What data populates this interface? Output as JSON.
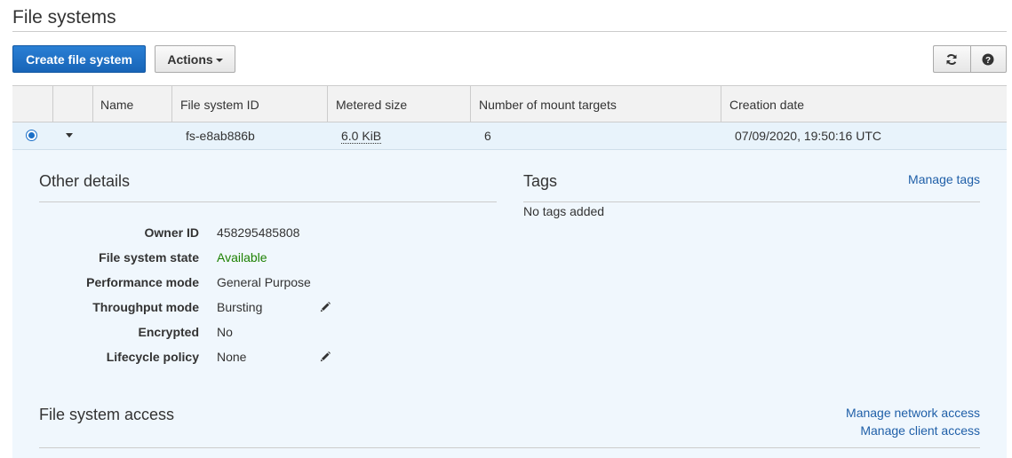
{
  "page": {
    "title": "File systems"
  },
  "toolbar": {
    "create_label": "Create file system",
    "actions_label": "Actions",
    "refresh_icon": "refresh-icon",
    "help_icon": "help-icon"
  },
  "table": {
    "columns": [
      "Name",
      "File system ID",
      "Metered size",
      "Number of mount targets",
      "Creation date"
    ],
    "row": {
      "name": "",
      "id": "fs-e8ab886b",
      "size": "6.0 KiB",
      "mount_targets": "6",
      "created": "07/09/2020, 19:50:16 UTC"
    }
  },
  "details": {
    "other_title": "Other details",
    "fields": [
      {
        "label": "Owner ID",
        "value": "458295485808"
      },
      {
        "label": "File system state",
        "value": "Available"
      },
      {
        "label": "Performance mode",
        "value": "General Purpose"
      },
      {
        "label": "Throughput mode",
        "value": "Bursting"
      },
      {
        "label": "Encrypted",
        "value": "No"
      },
      {
        "label": "Lifecycle policy",
        "value": "None"
      }
    ],
    "tags_title": "Tags",
    "manage_tags": "Manage tags",
    "no_tags": "No tags added",
    "access_title": "File system access",
    "manage_network": "Manage network access",
    "manage_client": "Manage client access"
  },
  "colors": {
    "primary": "#1a6fc7",
    "available": "#1d8102",
    "link": "#1f5fa8",
    "selected_row": "#e8f3fb"
  }
}
